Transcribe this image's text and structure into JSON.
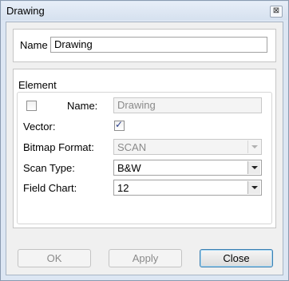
{
  "window": {
    "title": "Drawing",
    "close_glyph": "⊠"
  },
  "name_panel": {
    "label": "Name",
    "value": "Drawing"
  },
  "element": {
    "group_label": "Element",
    "name_label": "Name:",
    "name_value": "Drawing",
    "name_checked": false,
    "vector_label": "Vector:",
    "vector_checked": true,
    "bitmap_format_label": "Bitmap Format:",
    "bitmap_format_value": "SCAN",
    "scan_type_label": "Scan Type:",
    "scan_type_value": "B&W",
    "field_chart_label": "Field Chart:",
    "field_chart_value": "12"
  },
  "buttons": {
    "ok": "OK",
    "apply": "Apply",
    "close": "Close"
  },
  "checkmark_glyph": "✓"
}
